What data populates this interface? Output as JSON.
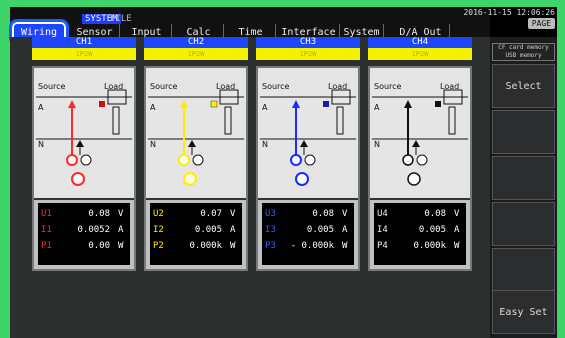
{
  "header": {
    "crumbs": [
      "SYSTEM",
      "FILE"
    ],
    "tabs": [
      "Wiring",
      "Sensor",
      "Input",
      "Calc",
      "Time",
      "Interface",
      "System",
      "D/A Out"
    ],
    "datetime": "2016-11-15 12:06:26",
    "page_button": "PAGE"
  },
  "channels": [
    {
      "name": "CH1",
      "range": "1P2W",
      "color": "#ff2a2a",
      "source": "Source",
      "load": "Load",
      "a": "A",
      "n": "N",
      "readout": [
        {
          "label": "U1",
          "value": "0.08",
          "unit": "V"
        },
        {
          "label": "I1",
          "value": "0.0052",
          "unit": "A"
        },
        {
          "label": "P1",
          "value": "0.00",
          "unit": "W"
        }
      ]
    },
    {
      "name": "CH2",
      "range": "1P2W",
      "color": "#ffee00",
      "source": "Source",
      "load": "Load",
      "a": "A",
      "n": "N",
      "readout": [
        {
          "label": "U2",
          "value": "0.07",
          "unit": "V"
        },
        {
          "label": "I2",
          "value": "0.005",
          "unit": "A"
        },
        {
          "label": "P2",
          "value": "0.000k",
          "unit": "W"
        }
      ]
    },
    {
      "name": "CH3",
      "range": "1P2W",
      "color": "#1a2bff",
      "source": "Source",
      "load": "Load",
      "a": "A",
      "n": "N",
      "readout": [
        {
          "label": "U3",
          "value": "0.08",
          "unit": "V"
        },
        {
          "label": "I3",
          "value": "0.005",
          "unit": "A"
        },
        {
          "label": "P3",
          "value": "- 0.000k",
          "unit": "W"
        }
      ]
    },
    {
      "name": "CH4",
      "range": "1P2W",
      "color": "#e8e8e8",
      "source": "Source",
      "load": "Load",
      "a": "A",
      "n": "N",
      "readout": [
        {
          "label": "U4",
          "value": "0.08",
          "unit": "V"
        },
        {
          "label": "I4",
          "value": "0.005",
          "unit": "A"
        },
        {
          "label": "P4",
          "value": "0.000k",
          "unit": "W"
        }
      ]
    }
  ],
  "right_menu": {
    "memory_lines": [
      "CF card memory",
      "USB memory"
    ],
    "buttons": [
      "Select",
      "",
      "",
      "",
      "",
      "Easy Set"
    ]
  }
}
